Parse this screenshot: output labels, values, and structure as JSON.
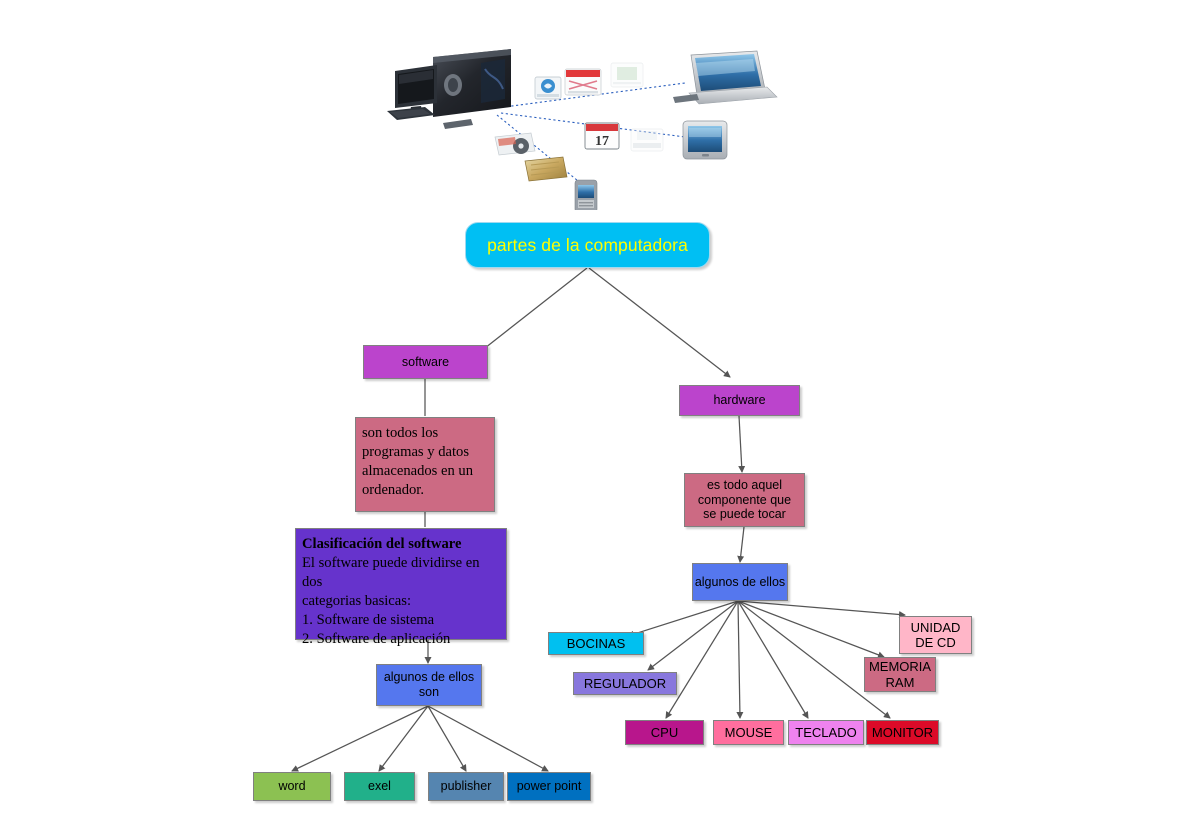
{
  "diagram": {
    "title": "partes de la computadora",
    "illustration": {
      "name": "computer-network-illustration",
      "devices": [
        "desktop-pc",
        "laptop",
        "tablet",
        "pda-phone"
      ],
      "media_icons": [
        "email-icon",
        "document-icon",
        "faded-icon",
        "calendar-17-icon",
        "printer-icon",
        "cd-media-icon",
        "memory-card-icon"
      ],
      "link_style": "dotted-blue"
    },
    "nodes": {
      "root": {
        "label": "partes de la computadora",
        "fill": "#00BFF3",
        "text_color": "#FFFF00"
      },
      "software": {
        "label": "software",
        "fill": "#BB44CC",
        "text_color": "#000000"
      },
      "software_def": {
        "lines": [
          "son todos los",
          "programas y datos",
          "almacenados en un",
          "ordenador."
        ],
        "fill": "#CC6A83",
        "text_color": "#000000"
      },
      "software_class": {
        "heading": "Clasificación del software",
        "lines": [
          "El software puede dividirse en dos",
          "categorias basicas:",
          "1. Software de sistema",
          "2. Software de aplicación"
        ],
        "fill": "#6633CC",
        "text_color": "#000000"
      },
      "software_some": {
        "label": "algunos de ellos son",
        "fill": "#5577EE",
        "text_color": "#000000"
      },
      "hardware": {
        "label": "hardware",
        "fill": "#BB44CC",
        "text_color": "#000000"
      },
      "hardware_def": {
        "lines": [
          "es todo aquel",
          "componente que",
          "se puede tocar"
        ],
        "fill": "#CC6A83",
        "text_color": "#000000"
      },
      "hardware_some": {
        "label": "algunos de ellos",
        "fill": "#5577EE",
        "text_color": "#000000"
      }
    },
    "software_items": [
      {
        "label": "word",
        "fill": "#8CC152"
      },
      {
        "label": "exel",
        "fill": "#21B08A"
      },
      {
        "label": "publisher",
        "fill": "#5585B0"
      },
      {
        "label": "power point",
        "fill": "#0070C0"
      }
    ],
    "hardware_items": [
      {
        "label": "BOCINAS",
        "fill": "#00C0F0"
      },
      {
        "label": "REGULADOR",
        "fill": "#8877DD"
      },
      {
        "label": "UNIDAD DE CD",
        "fill": "#FFB6C8"
      },
      {
        "label": "MEMORIA RAM",
        "fill": "#CC6A83"
      },
      {
        "label": "CPU",
        "fill": "#B8168C"
      },
      {
        "label": "MOUSE",
        "fill": "#FF6E9E"
      },
      {
        "label": "TECLADO",
        "fill": "#EE82EE"
      },
      {
        "label": "MONITOR",
        "fill": "#DC0A28"
      }
    ],
    "edge_color": "#555555",
    "background": "#FFFFFF"
  }
}
